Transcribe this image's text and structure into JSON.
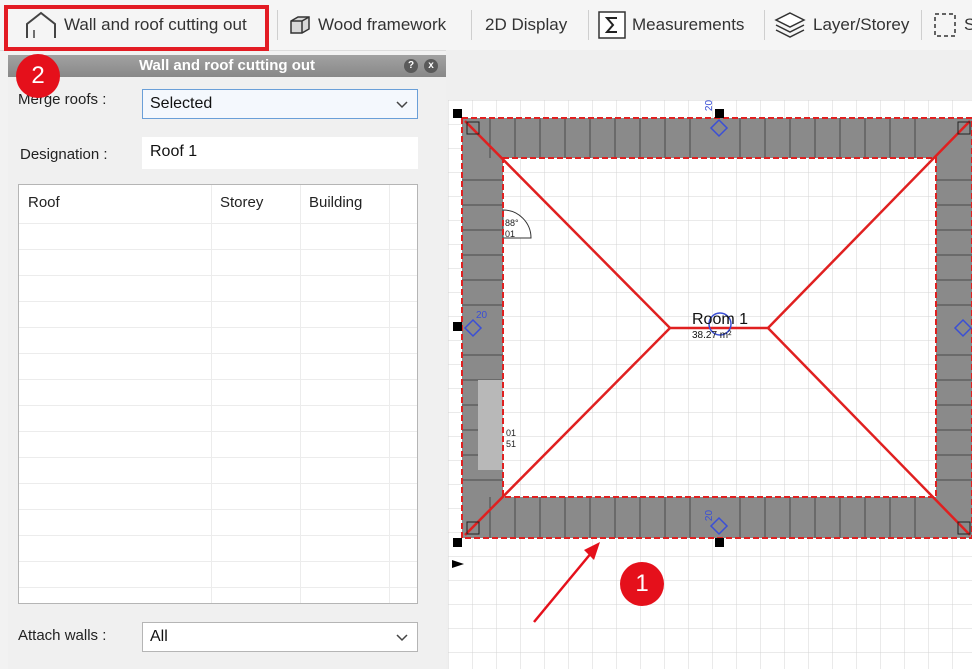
{
  "toolbar": {
    "items": [
      {
        "label": "Wall and roof cutting out",
        "icon": "house-outline-icon"
      },
      {
        "label": "Wood framework",
        "icon": "cube-icon"
      },
      {
        "label": "2D Display",
        "icon": ""
      },
      {
        "label": "Measurements",
        "icon": "sigma-icon"
      },
      {
        "label": "Layer/Storey",
        "icon": "layers-icon"
      },
      {
        "label": "S",
        "icon": "selection-frame-icon"
      }
    ]
  },
  "dialog": {
    "title": "Wall and roof cutting out",
    "help_glyph": "?",
    "close_glyph": "x",
    "merge_roofs_label": "Merge roofs :",
    "merge_roofs_value": "Selected",
    "designation_label": "Designation :",
    "designation_value": "Roof 1",
    "table_columns": [
      "Roof",
      "Storey",
      "Building"
    ],
    "attach_walls_label": "Attach walls :",
    "attach_walls_value": "All"
  },
  "plan": {
    "room_name": "Room 1",
    "room_area": "38.27 m²",
    "marker_top": "20",
    "marker_left": "20",
    "marker_bottom": "20",
    "dim_a": "88°",
    "dim_b": "01",
    "dim_c": "01",
    "dim_d": "51"
  },
  "annotations": {
    "badge_1": "1",
    "badge_2": "2"
  },
  "colors": {
    "highlight": "#e31c24",
    "roof_line": "#e02020",
    "wall_fill": "#8a8a8a",
    "marker_blue": "#3a4fd6"
  }
}
